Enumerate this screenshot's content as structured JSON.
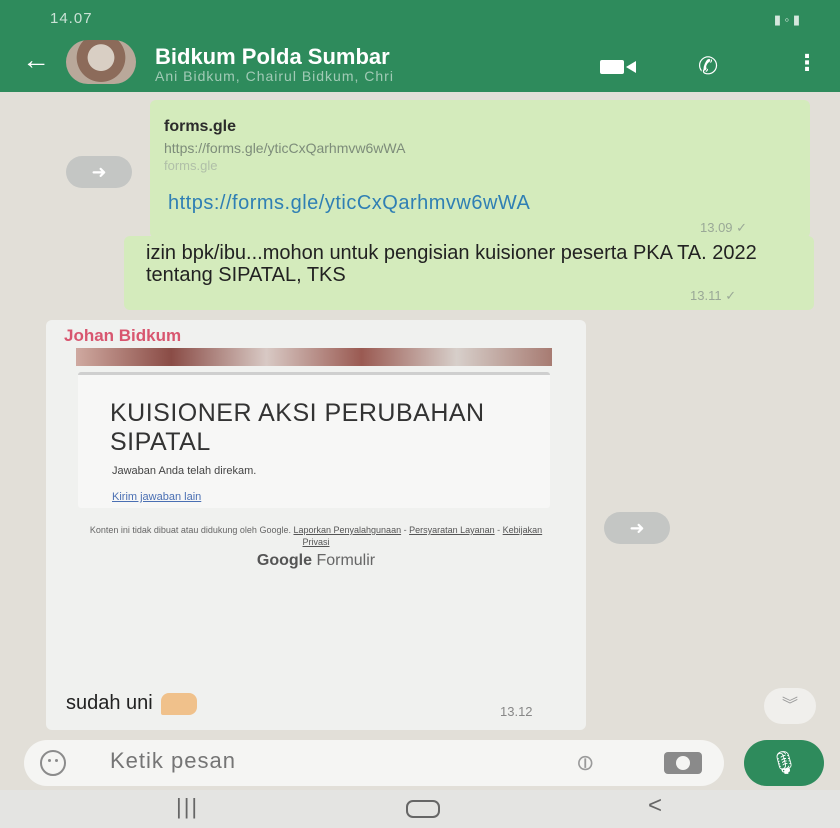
{
  "status_bar": {
    "time": "14.07"
  },
  "header": {
    "title": "Bidkum Polda Sumbar",
    "subtitle": "Ani Bidkum, Chairul Bidkum, Chri",
    "colors": {
      "header_bg": "#2e8b5c"
    }
  },
  "messages": {
    "link": {
      "preview_title": "forms.gle",
      "preview_url": "https://forms.gle/yticCxQarhmvw6wWA",
      "preview_domain": "forms.gle",
      "link_text": "https://forms.gle/yticCxQarhmvw6wWA",
      "time": "13.09"
    },
    "text": {
      "body": "izin bpk/ibu...mohon  untuk pengisian kuisioner peserta PKA TA. 2022 tentang SIPATAL, TKS",
      "time": "13.11"
    },
    "incoming": {
      "sender": "Johan Bidkum",
      "form_title": "KUISIONER AKSI PERUBAHAN SIPATAL",
      "form_message": "Jawaban Anda telah direkam.",
      "form_link": "Kirim jawaban lain",
      "footer_text": "Konten ini tidak dibuat atau didukung oleh Google.",
      "footer_links": [
        "Laporkan Penyalahgunaan",
        "Persyaratan Layanan",
        "Kebijakan Privasi"
      ],
      "brand_google": "Google",
      "brand_formulir": "Formulir",
      "reply_text": "sudah uni",
      "time": "13.12"
    }
  },
  "composer": {
    "placeholder": "Ketik pesan"
  },
  "icons": [
    "back-arrow-icon",
    "video-call-icon",
    "phone-icon",
    "more-vert-icon",
    "forward-icon",
    "emoji-icon",
    "attach-icon",
    "camera-icon",
    "mic-icon",
    "scroll-down-icon"
  ]
}
